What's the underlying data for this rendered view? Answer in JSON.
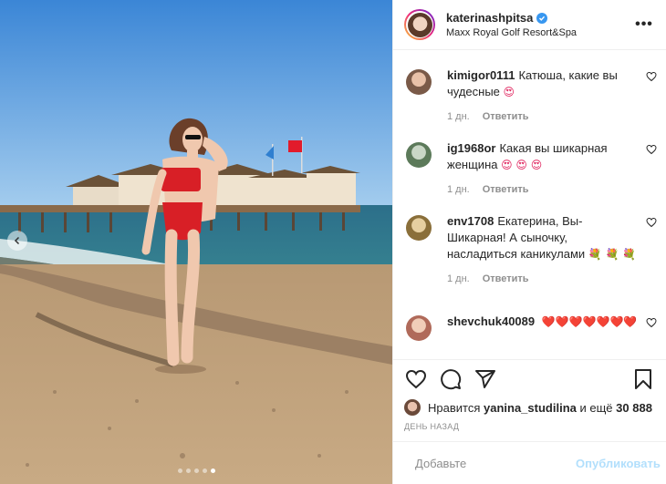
{
  "post": {
    "author": "katerinashpitsa",
    "location": "Maxx Royal Golf Resort&Spa",
    "more_label": "•••"
  },
  "comments": [
    {
      "user": "kimigor0111",
      "text": "Катюша, какие вы чудесные",
      "emoji": "😍",
      "time": "1 дн.",
      "reply": "Ответить",
      "avatar_color": "#7a5a48"
    },
    {
      "user": "ig1968or",
      "text": "Какая вы шикарная женщина",
      "emoji": "😍 😍 😍",
      "time": "1 дн.",
      "reply": "Ответить",
      "avatar_color": "#5c7a5a"
    },
    {
      "user": "env1708",
      "text": "Екатерина, Вы- Шикарная! А сыночку, насладиться каникулами",
      "emoji": "💐 💐 💐",
      "time": "1 дн.",
      "reply": "Ответить",
      "avatar_color": "#8a6f3a"
    },
    {
      "user": "shevchuk40089",
      "text": "",
      "emoji": "❤️❤️❤️❤️❤️❤️❤️",
      "time": "",
      "reply": "",
      "avatar_color": "#b06a5a"
    }
  ],
  "likes": {
    "prefix": "Нравится",
    "user": "yanina_studilina",
    "suffix": "и ещё",
    "count": "30 888"
  },
  "date": "ДЕНЬ НАЗАД",
  "add_comment": {
    "placeholder": "Добавьте комментарий...",
    "visible_placeholder": "Добавьте",
    "publish": "Опубликовать"
  },
  "carousel": {
    "dots": 5,
    "active": 4
  },
  "icons": {
    "like": "heart-icon",
    "comment": "comment-icon",
    "share": "share-icon",
    "save": "bookmark-icon",
    "emoji": "emoji-icon",
    "more": "more-icon"
  },
  "colors": {
    "accent": "#3897f0",
    "publish_disabled": "#b2dffc",
    "border": "#efefef",
    "muted": "#8e8e8e"
  }
}
